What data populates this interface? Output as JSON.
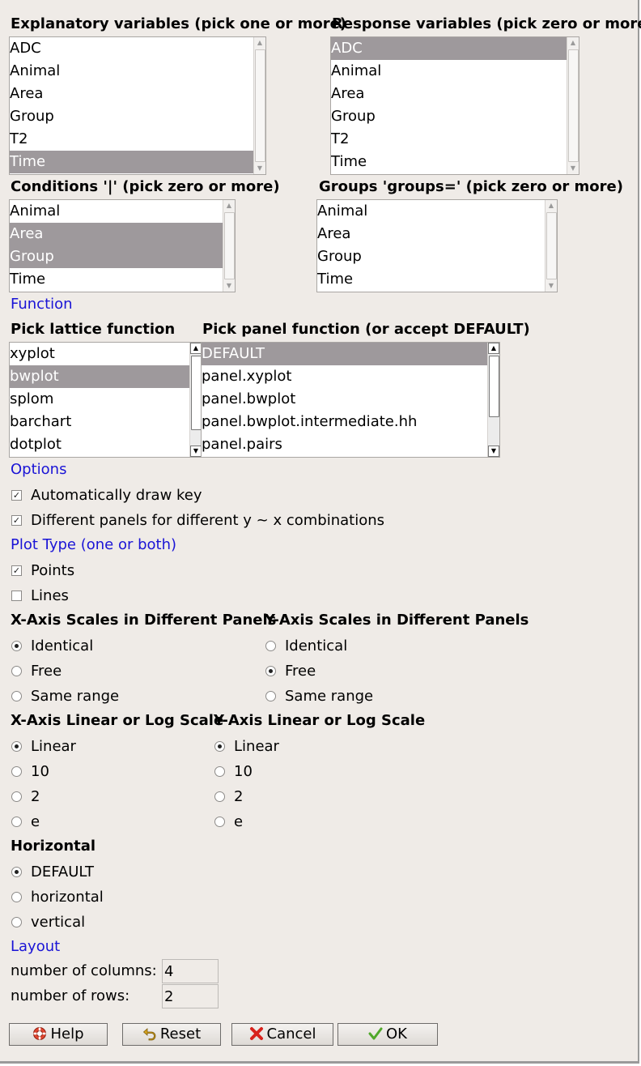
{
  "explanatory": {
    "title": "Explanatory variables (pick one or more)",
    "items": [
      "ADC",
      "Animal",
      "Area",
      "Group",
      "T2",
      "Time"
    ],
    "selected": [
      "Time"
    ]
  },
  "response": {
    "title": "Response variables (pick zero or more)",
    "items": [
      "ADC",
      "Animal",
      "Area",
      "Group",
      "T2",
      "Time"
    ],
    "selected": [
      "ADC"
    ]
  },
  "conditions": {
    "title": "Conditions '|' (pick zero or more)",
    "items": [
      "Animal",
      "Area",
      "Group",
      "Time"
    ],
    "selected": [
      "Area",
      "Group"
    ]
  },
  "groups": {
    "title": "Groups 'groups=' (pick zero or more)",
    "items": [
      "Animal",
      "Area",
      "Group",
      "Time"
    ],
    "selected": []
  },
  "function_section": "Function",
  "lattice": {
    "title": "Pick lattice function",
    "items": [
      "xyplot",
      "bwplot",
      "splom",
      "barchart",
      "dotplot"
    ],
    "selected": [
      "bwplot"
    ]
  },
  "panel": {
    "title": "Pick panel function (or accept DEFAULT)",
    "items": [
      "DEFAULT",
      "panel.xyplot",
      "panel.bwplot",
      "panel.bwplot.intermediate.hh",
      "panel.pairs"
    ],
    "selected": [
      "DEFAULT"
    ]
  },
  "options_section": "Options",
  "options": [
    {
      "label": "Automatically draw key",
      "checked": true
    },
    {
      "label": "Different panels for different y ~ x combinations",
      "checked": true
    }
  ],
  "plot_type_section": "Plot Type (one or both)",
  "plot_type": [
    {
      "label": "Points",
      "checked": true
    },
    {
      "label": "Lines",
      "checked": false
    }
  ],
  "x_scales": {
    "title": "X-Axis Scales in Different Panels",
    "options": [
      "Identical",
      "Free",
      "Same range"
    ],
    "selected": "Identical"
  },
  "y_scales": {
    "title": "Y-Axis Scales in Different Panels",
    "options": [
      "Identical",
      "Free",
      "Same range"
    ],
    "selected": "Free"
  },
  "x_log": {
    "title": "X-Axis Linear or Log Scale",
    "options": [
      "Linear",
      "10",
      "2",
      "e"
    ],
    "selected": "Linear"
  },
  "y_log": {
    "title": "Y-Axis Linear or Log Scale",
    "options": [
      "Linear",
      "10",
      "2",
      "e"
    ],
    "selected": "Linear"
  },
  "horizontal": {
    "title": "Horizontal",
    "options": [
      "DEFAULT",
      "horizontal",
      "vertical"
    ],
    "selected": "DEFAULT"
  },
  "layout_section": "Layout",
  "layout": {
    "columns_label": "number of columns:",
    "columns_value": "4",
    "rows_label": "number of rows:",
    "rows_value": "2"
  },
  "buttons": {
    "help": "Help",
    "reset": "Reset",
    "cancel": "Cancel",
    "ok": "OK"
  },
  "colors": {
    "section": "#1a14d6",
    "selection": "#9e999c",
    "background": "#efebe7"
  }
}
